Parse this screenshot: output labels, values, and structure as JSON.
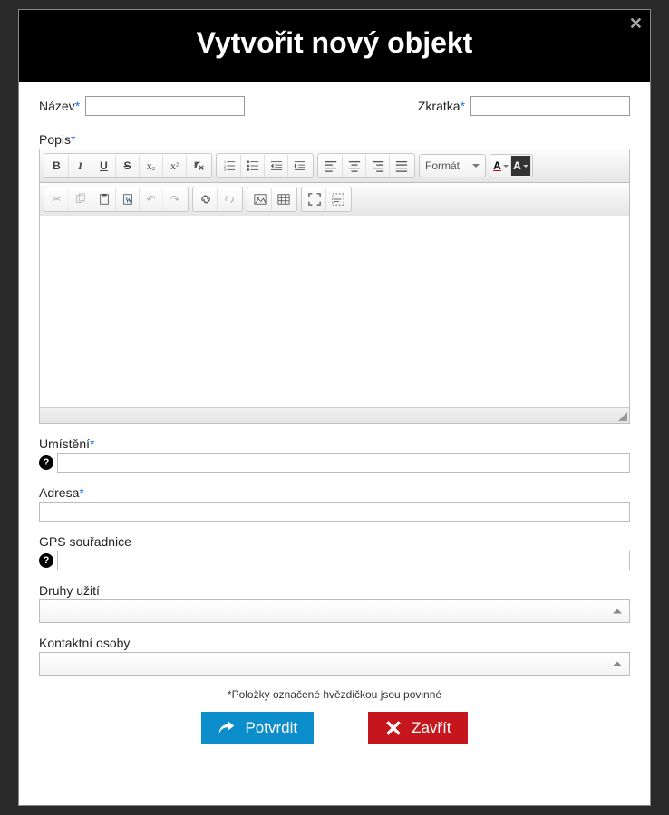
{
  "modal": {
    "title": "Vytvořit nový objekt"
  },
  "fields": {
    "nazev": {
      "label": "Název",
      "value": ""
    },
    "zkratka": {
      "label": "Zkratka",
      "value": ""
    },
    "popis": {
      "label": "Popis"
    },
    "umisteni": {
      "label": "Umístění",
      "value": ""
    },
    "adresa": {
      "label": "Adresa",
      "value": ""
    },
    "gps": {
      "label": "GPS souřadnice",
      "value": ""
    },
    "druhy": {
      "label": "Druhy užití",
      "value": ""
    },
    "kontakty": {
      "label": "Kontaktní osoby",
      "value": ""
    }
  },
  "editor": {
    "format_label": "Formát"
  },
  "notes": {
    "required": "*Položky označené hvězdičkou jsou povinné"
  },
  "buttons": {
    "confirm": "Potvrdit",
    "close": "Zavřít"
  },
  "asterisk": "*"
}
